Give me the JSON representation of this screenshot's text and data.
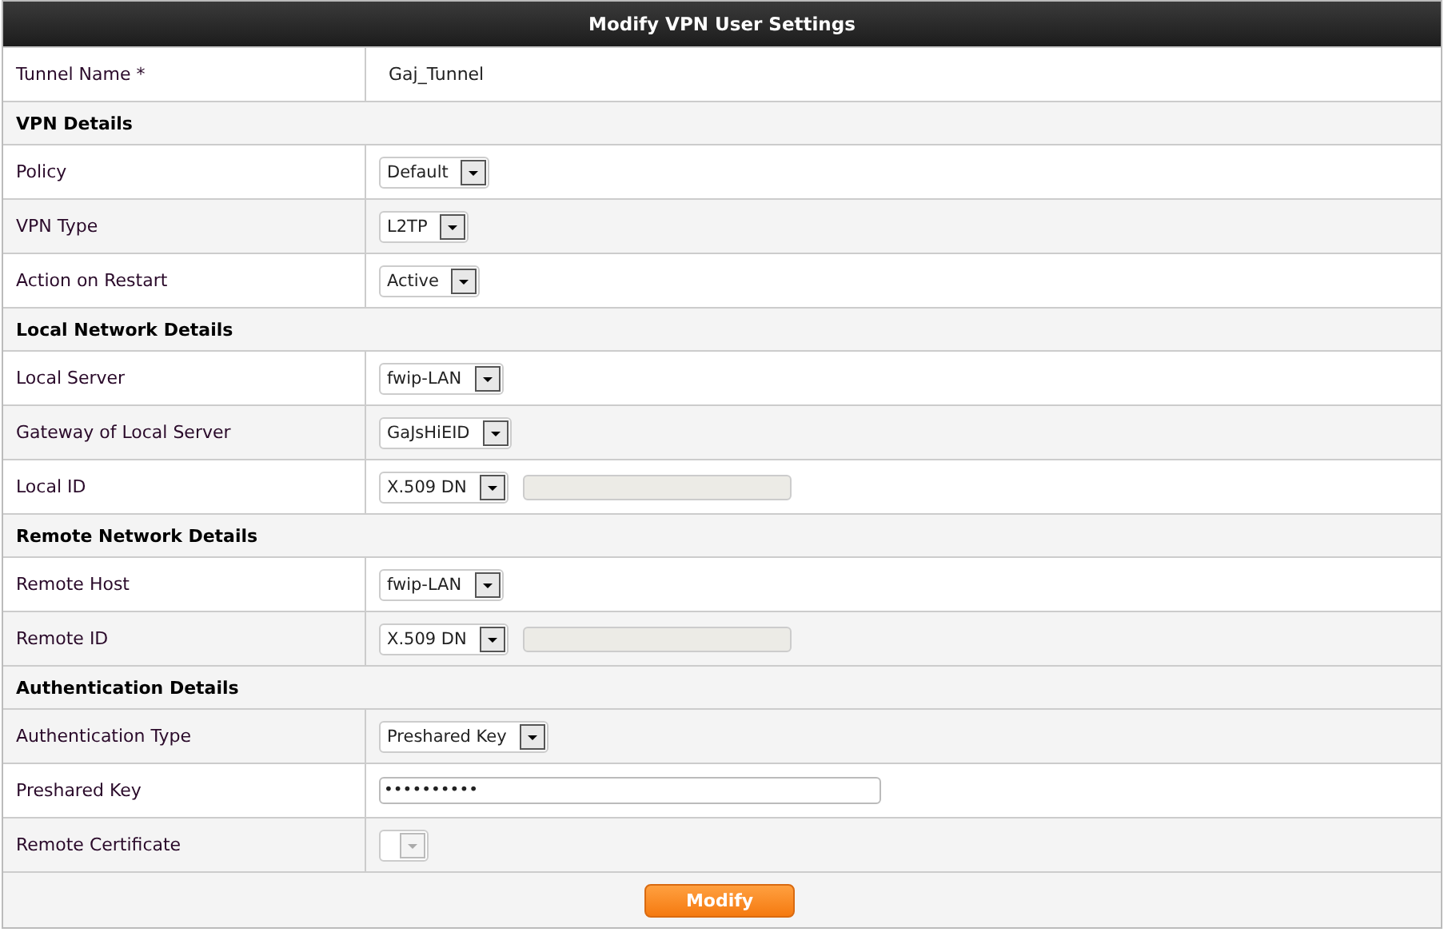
{
  "title": "Modify VPN User Settings",
  "sections": [
    {
      "rows": [
        {
          "label": "Tunnel Name *",
          "kind": "text",
          "value": "Gaj_Tunnel"
        }
      ]
    },
    {
      "heading": "VPN Details",
      "rows": [
        {
          "label": "Policy",
          "kind": "select",
          "value": "Default"
        },
        {
          "label": "VPN Type",
          "kind": "select",
          "value": "L2TP"
        },
        {
          "label": "Action on Restart",
          "kind": "select",
          "value": "Active"
        }
      ]
    },
    {
      "heading": "Local Network Details",
      "rows": [
        {
          "label": "Local Server",
          "kind": "select",
          "value": "fwip-LAN"
        },
        {
          "label": "Gateway of Local Server",
          "kind": "select",
          "value": "GaJsHiEID"
        },
        {
          "label": "Local ID",
          "kind": "select_field",
          "value": "X.509 DN",
          "field_disabled": true
        }
      ]
    },
    {
      "heading": "Remote Network Details",
      "rows": [
        {
          "label": "Remote Host",
          "kind": "select",
          "value": "fwip-LAN"
        },
        {
          "label": "Remote ID",
          "kind": "select_field",
          "value": "X.509 DN",
          "field_disabled": true
        }
      ]
    },
    {
      "heading": "Authentication Details",
      "rows": [
        {
          "label": "Authentication Type",
          "kind": "select",
          "value": "Preshared Key"
        },
        {
          "label": "Preshared Key",
          "kind": "password",
          "value": "••••••••••"
        },
        {
          "label": "Remote Certificate",
          "kind": "select",
          "value": null,
          "disabled": true
        }
      ]
    }
  ],
  "button": "Modify"
}
